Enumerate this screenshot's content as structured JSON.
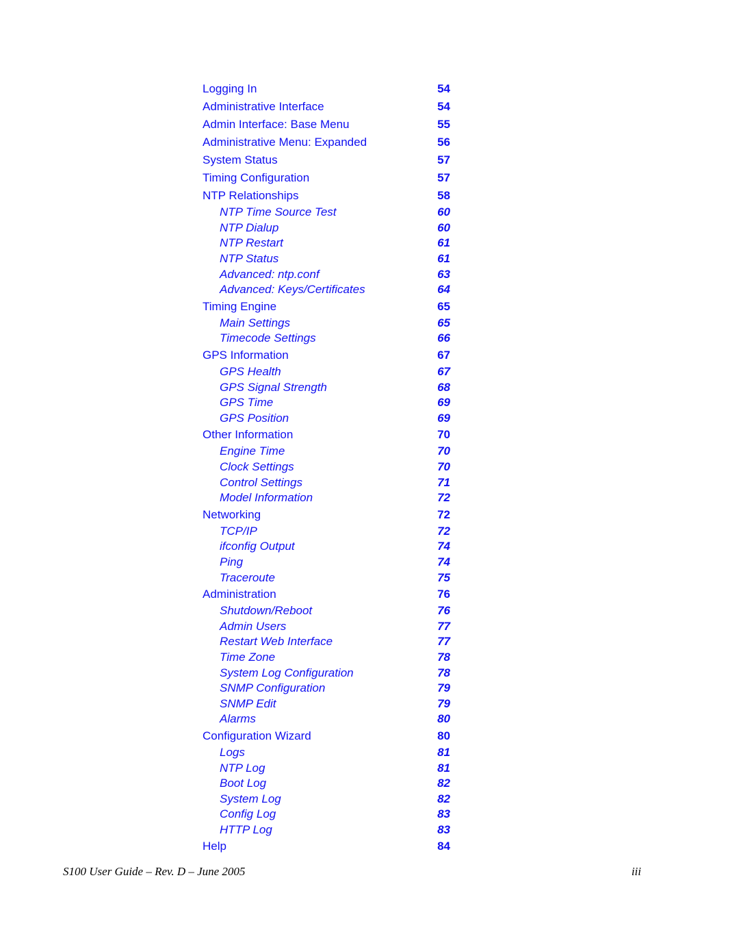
{
  "link_color": "#1010f0",
  "toc": [
    {
      "level": 1,
      "title": "Logging In",
      "page": "54"
    },
    {
      "level": 1,
      "title": "Administrative Interface",
      "page": "54"
    },
    {
      "level": 1,
      "title": "Admin Interface: Base Menu",
      "page": "55"
    },
    {
      "level": 1,
      "title": "Administrative Menu: Expanded",
      "page": "56"
    },
    {
      "level": 1,
      "title": "System Status",
      "page": "57"
    },
    {
      "level": 1,
      "title": "Timing Configuration",
      "page": "57"
    },
    {
      "level": 1,
      "title": "NTP Relationships",
      "page": "58"
    },
    {
      "level": 2,
      "title": "NTP Time Source Test",
      "page": "60"
    },
    {
      "level": 2,
      "title": "NTP Dialup",
      "page": "60"
    },
    {
      "level": 2,
      "title": "NTP Restart",
      "page": "61"
    },
    {
      "level": 2,
      "title": "NTP Status",
      "page": "61"
    },
    {
      "level": 2,
      "title": "Advanced: ntp.conf",
      "page": "63"
    },
    {
      "level": 2,
      "title": "Advanced: Keys/Certificates",
      "page": "64"
    },
    {
      "level": 1,
      "title": "Timing Engine",
      "page": "65"
    },
    {
      "level": 2,
      "title": "Main Settings",
      "page": "65"
    },
    {
      "level": 2,
      "title": "Timecode Settings",
      "page": "66"
    },
    {
      "level": 1,
      "title": "GPS Information",
      "page": "67"
    },
    {
      "level": 2,
      "title": "GPS Health",
      "page": "67"
    },
    {
      "level": 2,
      "title": "GPS Signal Strength",
      "page": "68"
    },
    {
      "level": 2,
      "title": "GPS Time",
      "page": "69"
    },
    {
      "level": 2,
      "title": "GPS Position",
      "page": "69"
    },
    {
      "level": 1,
      "title": "Other Information",
      "page": "70"
    },
    {
      "level": 2,
      "title": "Engine Time",
      "page": "70"
    },
    {
      "level": 2,
      "title": "Clock Settings",
      "page": "70"
    },
    {
      "level": 2,
      "title": "Control Settings",
      "page": "71"
    },
    {
      "level": 2,
      "title": "Model Information",
      "page": "72"
    },
    {
      "level": 1,
      "title": "Networking",
      "page": "72"
    },
    {
      "level": 2,
      "title": "TCP/IP",
      "page": "72"
    },
    {
      "level": 2,
      "title": "ifconfig Output",
      "page": "74"
    },
    {
      "level": 2,
      "title": "Ping",
      "page": "74"
    },
    {
      "level": 2,
      "title": "Traceroute",
      "page": "75"
    },
    {
      "level": 1,
      "title": "Administration",
      "page": "76"
    },
    {
      "level": 2,
      "title": "Shutdown/Reboot",
      "page": "76"
    },
    {
      "level": 2,
      "title": "Admin Users",
      "page": "77"
    },
    {
      "level": 2,
      "title": "Restart Web Interface",
      "page": "77"
    },
    {
      "level": 2,
      "title": "Time Zone",
      "page": "78"
    },
    {
      "level": 2,
      "title": "System Log Configuration",
      "page": "78"
    },
    {
      "level": 2,
      "title": "SNMP Configuration",
      "page": "79"
    },
    {
      "level": 2,
      "title": "SNMP Edit",
      "page": "79"
    },
    {
      "level": 2,
      "title": "Alarms",
      "page": "80"
    },
    {
      "level": 1,
      "title": "Configuration Wizard",
      "page": "80"
    },
    {
      "level": 2,
      "title": "Logs",
      "page": "81"
    },
    {
      "level": 2,
      "title": "NTP Log",
      "page": "81"
    },
    {
      "level": 2,
      "title": "Boot Log",
      "page": "82"
    },
    {
      "level": 2,
      "title": "System Log",
      "page": "82"
    },
    {
      "level": 2,
      "title": "Config Log",
      "page": "83"
    },
    {
      "level": 2,
      "title": "HTTP Log",
      "page": "83"
    },
    {
      "level": 1,
      "title": "Help",
      "page": "84"
    }
  ],
  "footer": {
    "left": "S100 User Guide – Rev. D – June 2005",
    "right": "iii"
  }
}
